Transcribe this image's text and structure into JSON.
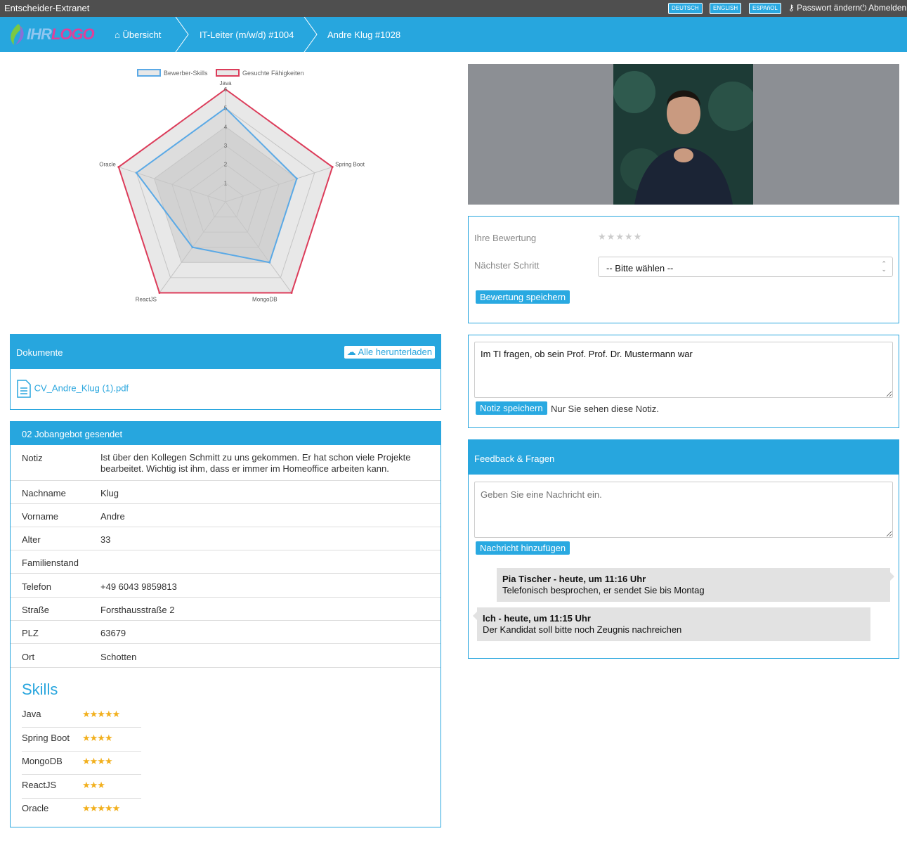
{
  "topbar": {
    "title": "Entscheider-Extranet",
    "languages": [
      "DEUTSCH",
      "ENGLISH",
      "ESPAñOL"
    ],
    "password": "Passwort ändern",
    "logout": "Abmelden"
  },
  "nav": {
    "logo": "IHRLOGO",
    "breadcrumbs": [
      "Übersicht",
      "IT-Leiter (m/w/d) #1004",
      "Andre Klug #1028"
    ]
  },
  "colors": {
    "primary": "#27a6de",
    "topbar": "#4f4f4f",
    "star": "#f2b01e",
    "series_applicant": "#5aa9e6",
    "series_required": "#dc3c5a"
  },
  "chart_data": {
    "type": "radar",
    "categories": [
      "Java",
      "Spring Boot",
      "MongoDB",
      "ReactJS",
      "Oracle"
    ],
    "scale": {
      "min": 0,
      "max": 6,
      "ticks": [
        "1",
        "2",
        "3",
        "4",
        "5",
        "6"
      ]
    },
    "legend": "top",
    "series": [
      {
        "name": "Bewerber-Skills",
        "values": [
          5,
          4,
          4,
          3,
          5
        ]
      },
      {
        "name": "Gesuchte Fähigkeiten",
        "values": [
          6,
          6,
          6,
          6,
          6
        ]
      }
    ]
  },
  "documents": {
    "title": "Dokumente",
    "download_all": "Alle herunterladen",
    "files": [
      "CV_Andre_Klug (1).pdf"
    ]
  },
  "details": {
    "status": "02 Jobangebot gesendet",
    "rows": [
      {
        "label": "Notiz",
        "value": "Ist über den Kollegen Schmitt zu uns gekommen. Er hat schon viele Projekte bearbeitet. Wichtig ist ihm, dass er immer im Homeoffice arbeiten kann."
      },
      {
        "label": "Nachname",
        "value": "Klug"
      },
      {
        "label": "Vorname",
        "value": "Andre"
      },
      {
        "label": "Alter",
        "value": "33"
      },
      {
        "label": "Familienstand",
        "value": ""
      },
      {
        "label": "Telefon",
        "value": "+49 6043 9859813"
      },
      {
        "label": "Straße",
        "value": "Forsthausstraße 2"
      },
      {
        "label": "PLZ",
        "value": "63679"
      },
      {
        "label": "Ort",
        "value": "Schotten"
      }
    ]
  },
  "skills": {
    "title": "Skills",
    "items": [
      {
        "name": "Java",
        "stars": 5
      },
      {
        "name": "Spring Boot",
        "stars": 4
      },
      {
        "name": "MongoDB",
        "stars": 4
      },
      {
        "name": "ReactJS",
        "stars": 3
      },
      {
        "name": "Oracle",
        "stars": 5
      }
    ]
  },
  "rating": {
    "label": "Ihre Bewertung",
    "stars": 0,
    "next_step_label": "Nächster Schritt",
    "next_step_value": "-- Bitte wählen --",
    "save": "Bewertung speichern"
  },
  "note": {
    "value": "Im TI fragen, ob sein Prof. Prof. Dr. Mustermann war",
    "save": "Notiz speichern",
    "hint": "Nur Sie sehen diese Notiz."
  },
  "feedback": {
    "title": "Feedback & Fragen",
    "placeholder": "Geben Sie eine Nachricht ein.",
    "add": "Nachricht hinzufügen",
    "messages": [
      {
        "header": "Pia Tischer - heute, um 11:16 Uhr",
        "text": "Telefonisch besprochen, er sendet Sie bis Montag"
      },
      {
        "header": "Ich - heute, um 11:15 Uhr",
        "text": "Der Kandidat soll bitte noch Zeugnis nachreichen"
      }
    ]
  }
}
